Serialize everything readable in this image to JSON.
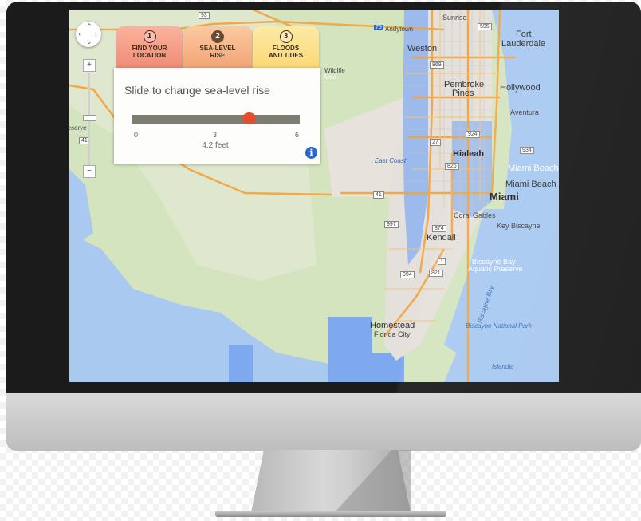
{
  "tabs": [
    {
      "number": "1",
      "line1": "FIND YOUR",
      "line2": "LOCATION"
    },
    {
      "number": "2",
      "line1": "SEA-LEVEL",
      "line2": "RISE"
    },
    {
      "number": "3",
      "line1": "FLOODS",
      "line2": "AND TIDES"
    }
  ],
  "panel": {
    "title": "Slide to change sea-level rise",
    "slider_min": "0",
    "slider_mid": "3",
    "slider_max": "6",
    "value_readout": "4.2 feet",
    "slider_value_feet": 4.2
  },
  "map": {
    "zoom_in": "+",
    "zoom_out": "−",
    "labels": {
      "sunrise": "Sunrise",
      "fort_lauderdale_1": "Fort",
      "fort_lauderdale_2": "Lauderdale",
      "andytown": "Andytown",
      "weston": "Weston",
      "pembroke_1": "Pembroke",
      "pembroke_2": "Pines",
      "hollywood": "Hollywood",
      "aventura": "Aventura",
      "hialeah": "Hialeah",
      "miami_beach_1": "Miami Beach",
      "miami_beach_2": "Miami Beach",
      "miami": "Miami",
      "east_coast": "East Coast",
      "coral_gables": "Coral Gables",
      "key_biscayne": "Key Biscayne",
      "kendall": "Kendall",
      "biscayne_bay_1": "Biscayne Bay",
      "biscayne_bay_2": "Aquatic Preserve",
      "biscayne_bay_vertical": "Biscayne Bay",
      "homestead": "Homestead",
      "florida_city": "Florida City",
      "biscayne_np": "Biscayne National Park",
      "islandia": "Islandia",
      "wildlife_1": "Wildlife",
      "wildlife_2": "Management Area",
      "preserve": "reserve"
    },
    "shields": {
      "r93": "93",
      "r75": "75",
      "r595": "595",
      "r869": "869",
      "r27": "27",
      "r41a": "41",
      "r41b": "41",
      "r997": "997",
      "r874": "874",
      "r994": "994",
      "r821": "821",
      "r1": "1",
      "r826": "826",
      "r924": "924",
      "r934": "934"
    }
  }
}
